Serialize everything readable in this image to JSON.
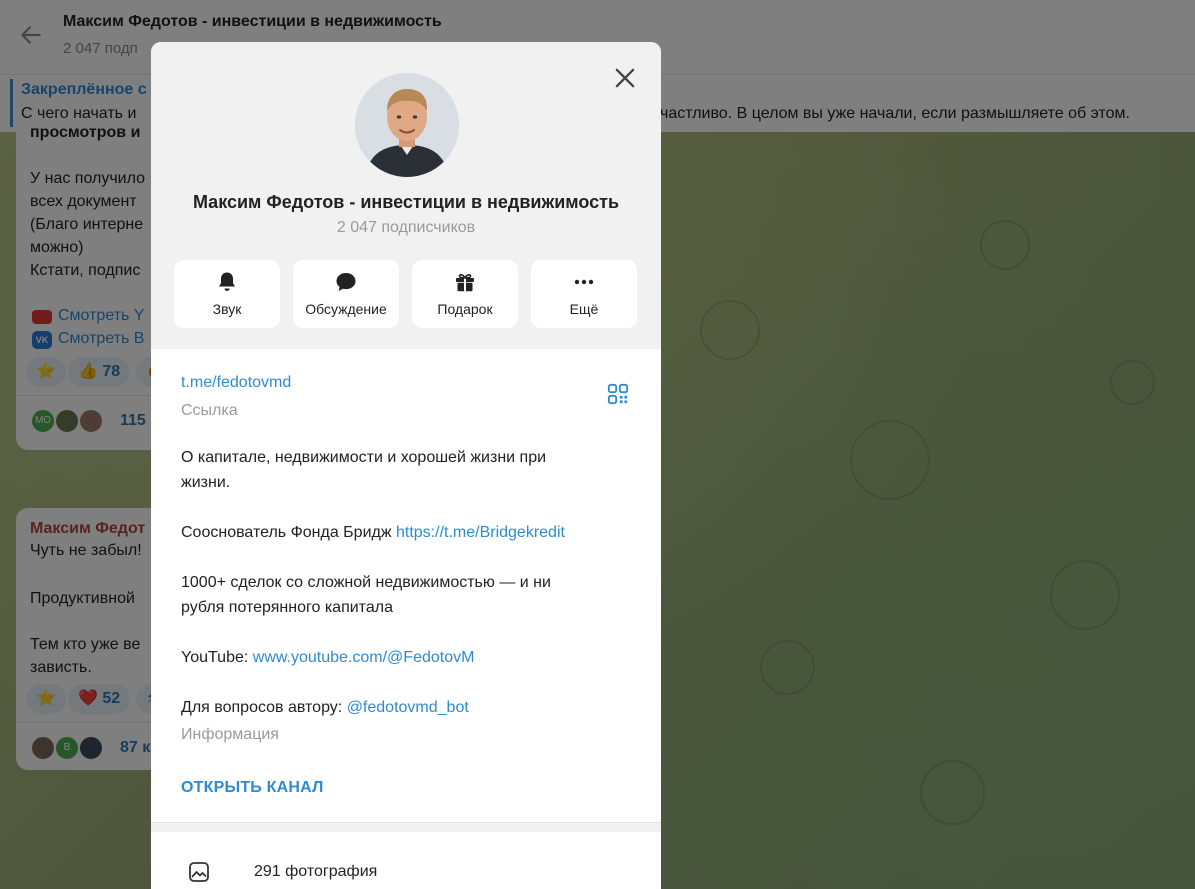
{
  "header": {
    "title": "Максим Федотов - инвестиции в недвижимость",
    "subtitle": "2 047 подп"
  },
  "pinned": {
    "title": "Закреплённое с",
    "text_left": "С чего начать и",
    "text_right": "частливо.  В целом вы уже начали, если размышляете об этом."
  },
  "messages": [
    {
      "lines": [
        "просмотров и",
        "У нас получило",
        "всех документ",
        "(Благо интерне",
        "можно)",
        "Кстати, подпис"
      ],
      "youtube_link": "Смотреть Y",
      "vk_link": "Смотреть В",
      "vk_icon_text": "VK",
      "reactions": [
        {
          "emoji": "⭐",
          "count": ""
        },
        {
          "emoji": "👍",
          "count": "78"
        },
        {
          "emoji": "🔥",
          "count": ""
        }
      ],
      "commenter_initials": "МО",
      "views": "115"
    },
    {
      "author": "Максим Федот",
      "lines": [
        "Чуть не забыл!",
        "Продуктивной",
        "Тем кто уже ве",
        "зависть."
      ],
      "reactions": [
        {
          "emoji": "⭐",
          "count": ""
        },
        {
          "emoji": "❤️",
          "count": "52"
        },
        {
          "emoji": "⚡",
          "count": ""
        }
      ],
      "commenter_initials": "В",
      "views": "87 к"
    }
  ],
  "profile": {
    "name": "Максим Федотов - инвестиции в недвижимость",
    "subscribers": "2 047 подписчиков",
    "actions": [
      {
        "label": "Звук",
        "icon": "bell-icon"
      },
      {
        "label": "Обсуждение",
        "icon": "chat-bubble-icon"
      },
      {
        "label": "Подарок",
        "icon": "gift-icon"
      },
      {
        "label": "Ещё",
        "icon": "more-dots-icon"
      }
    ],
    "link": "t.me/fedotovmd",
    "link_caption": "Ссылка",
    "about_line1": "О капитале, недвижимости и хорошей жизни при",
    "about_line2": "жизни.",
    "founder_text": "Сооснователь Фонда Бридж ",
    "founder_link": "https://t.me/Bridgekredit",
    "deals_line1": "1000+ сделок со сложной недвижимостью — и ни",
    "deals_line2": "рубля потерянного капитала",
    "youtube_text": "YouTube: ",
    "youtube_link": "www.youtube.com/@FedotovM",
    "questions_text": "Для вопросов автору: ",
    "questions_link": "@fedotovmd_bot",
    "info_caption": "Информация",
    "open_channel": "ОТКРЫТЬ КАНАЛ",
    "photos_label": "291 фотография"
  },
  "colors": {
    "accent": "#2e8bd2",
    "overlay": "rgba(0,0,0,0.5)",
    "author_name": "#b0453c"
  }
}
